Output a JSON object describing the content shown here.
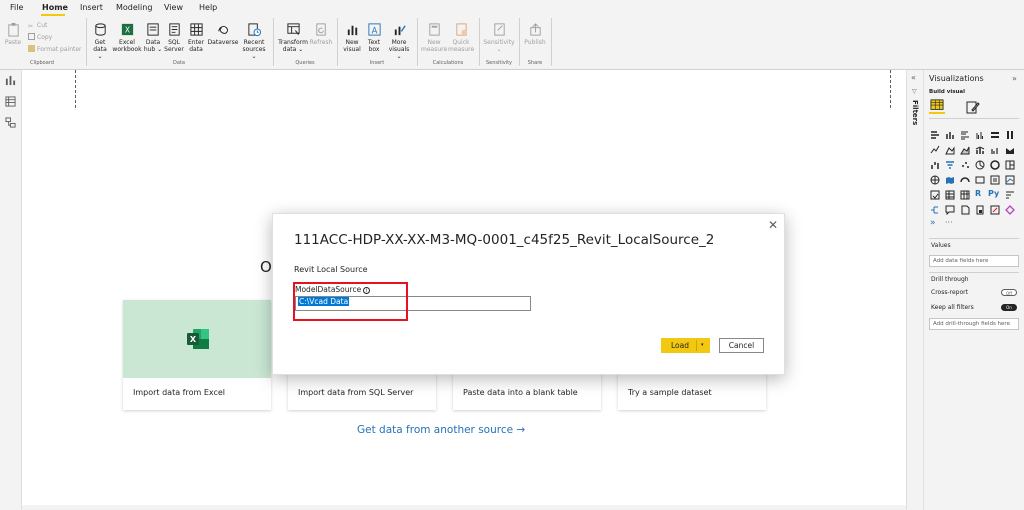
{
  "menu": {
    "tabs": [
      "File",
      "Home",
      "Insert",
      "Modeling",
      "View",
      "Help"
    ],
    "active": "Home"
  },
  "ribbon": {
    "clipboard": {
      "paste": "Paste",
      "cut": "Cut",
      "copy": "Copy",
      "format_painter": "Format painter",
      "group_label": "Clipboard"
    },
    "data": {
      "get_data": [
        "Get",
        "data ⌄"
      ],
      "excel_workbook": [
        "Excel",
        "workbook"
      ],
      "data_hub": [
        "Data",
        "hub ⌄"
      ],
      "sql_server": [
        "SQL",
        "Server"
      ],
      "enter_data": [
        "Enter",
        "data"
      ],
      "dataverse": [
        "Dataverse",
        ""
      ],
      "recent_sources": [
        "Recent",
        "sources ⌄"
      ],
      "group_label": "Data"
    },
    "queries": {
      "transform_data": [
        "Transform",
        "data ⌄"
      ],
      "refresh": [
        "Refresh",
        ""
      ],
      "group_label": "Queries"
    },
    "insert": {
      "new_visual": [
        "New",
        "visual"
      ],
      "text_box": [
        "Text",
        "box"
      ],
      "more_visuals": [
        "More",
        "visuals ⌄"
      ],
      "group_label": "Insert"
    },
    "calculations": {
      "new_measure": [
        "New",
        "measure"
      ],
      "quick_measure": [
        "Quick",
        "measure"
      ],
      "group_label": "Calculations"
    },
    "sensitivity": {
      "sensitivity": [
        "Sensitivity",
        "⌄"
      ],
      "group_label": "Sensitivity"
    },
    "share": {
      "publish": [
        "Publish",
        ""
      ],
      "group_label": "Share"
    }
  },
  "canvas": {
    "welcome_fragment": "O",
    "cards": [
      "Import data from Excel",
      "Import data from SQL Server",
      "Paste data into a blank table",
      "Try a sample dataset"
    ],
    "get_data_link": "Get data from another source →"
  },
  "filters": {
    "label": "Filters"
  },
  "visualizations": {
    "title": "Visualizations",
    "build_visual": "Build visual",
    "values_label": "Values",
    "values_placeholder": "Add data fields here",
    "drill_through": "Drill through",
    "cross_report": "Cross-report",
    "cross_report_toggle": "Off",
    "keep_all_filters": "Keep all filters",
    "keep_all_filters_toggle": "On",
    "drill_placeholder": "Add drill-through fields here",
    "more": "···"
  },
  "dialog": {
    "title": "111ACC-HDP-XX-XX-M3-MQ-0001_c45f25_Revit_LocalSource_2",
    "subtitle": "Revit Local Source",
    "parameter_label": "ModelDataSource",
    "info": "i",
    "parameter_value": "C:\\Vcad Data",
    "load": "Load",
    "load_caret": "▾",
    "cancel": "Cancel",
    "close": "✕"
  },
  "colors": {
    "accent": "#f2c811",
    "link": "#2673b8",
    "excel_green": "#1d6f42",
    "excel_card": "#c9e7d3",
    "highlight_box": "#e81123",
    "selection": "#0078d7"
  }
}
